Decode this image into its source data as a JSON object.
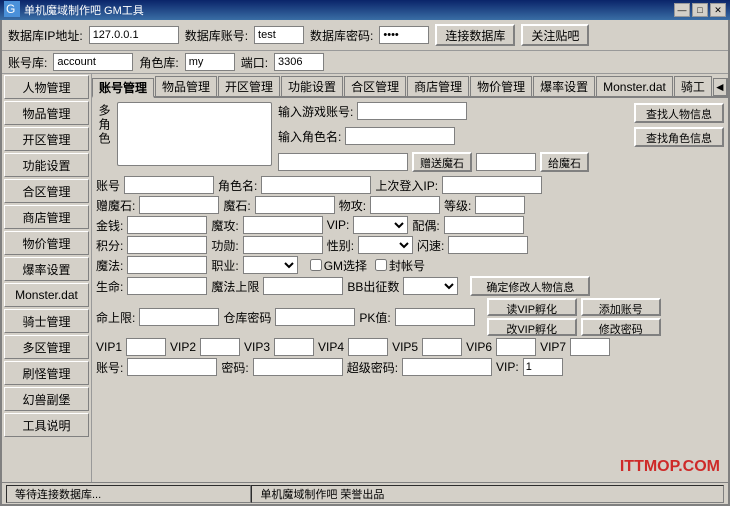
{
  "titleBar": {
    "title": "单机魔域制作吧 GM工具",
    "minimizeLabel": "—",
    "maximizeLabel": "□",
    "closeLabel": "✕"
  },
  "configBar": {
    "dbIpLabel": "数据库IP地址:",
    "dbIpValue": "127.0.0.1",
    "dbAccountLabel": "数据库账号:",
    "dbAccountValue": "test",
    "dbPasswordLabel": "数据库密码:",
    "dbPasswordValue": "****",
    "connectBtn": "连接数据库",
    "closeBtn": "关注贴吧"
  },
  "accountBar": {
    "dbLabel": "账号库:",
    "dbValue": "account",
    "roleLabel": "角色库:",
    "roleValue": "my",
    "portLabel": "端口:",
    "portValue": "3306"
  },
  "sidebar": {
    "items": [
      "人物管理",
      "物品管理",
      "开区管理",
      "功能设置",
      "合区管理",
      "商店管理",
      "物价管理",
      "爆率设置",
      "Monster.dat",
      "骑士管理",
      "多区管理",
      "刷怪管理",
      "幻兽副堡",
      "工具说明"
    ]
  },
  "tabs": {
    "items": [
      "账号管理",
      "物品管理",
      "开区管理",
      "功能设置",
      "合区管理",
      "商店管理",
      "物价管理",
      "爆率设置",
      "Monster.dat",
      "骑工"
    ],
    "activeIndex": 0,
    "navPrev": "◄",
    "navNext": "►"
  },
  "accountPanel": {
    "multiCharLabel": "多角色",
    "rightInputs": {
      "gameAccountLabel": "输入游戏账号:",
      "gameAccountValue": "",
      "roleNameLabel": "输入角色名:",
      "roleNameValue": "",
      "findAccountBtn": "查找人物信息",
      "findRoleBtn": "查找角色信息"
    },
    "giftMagicStoneBtn": "赠送魔石",
    "giveMagicStoneBtn": "给魔石",
    "infoRow1": {
      "accountLabel": "账号",
      "accountValue": "",
      "roleNameLabel": "角色名:",
      "roleNameValue": "",
      "lastLoginLabel": "上次登入IP:",
      "lastLoginValue": ""
    },
    "infoRow2": {
      "magicStoneLabel": "赠魔石:",
      "magicStoneValue": "",
      "magicLabel": "魔石:",
      "magicValue": "",
      "physAtkLabel": "物攻:",
      "physAtkValue": "",
      "levelLabel": "等级:",
      "levelValue": ""
    },
    "infoRow3": {
      "moneyLabel": "金钱:",
      "moneyValue": "",
      "magAtkLabel": "魔攻:",
      "magAtkValue": "",
      "vipLabel": "VIP:",
      "vipValue": "",
      "marriageLabel": "配偶:",
      "marriageValue": ""
    },
    "infoRow4": {
      "pointsLabel": "积分:",
      "pointsValue": "",
      "meritLabel": "功勋:",
      "meritValue": "",
      "genderLabel": "性别:",
      "genderValue": "",
      "flashLabel": "闪速:",
      "flashValue": ""
    },
    "infoRow5": {
      "magicMethodLabel": "魔法:",
      "magicMethodValue": "",
      "jobLabel": "职业:",
      "jobValue": ""
    },
    "gmCheckLabel": "GM选择",
    "sealLabel": "封帐号",
    "infoRow6": {
      "lifeLabel": "生命:",
      "lifeValue": "",
      "magicMaxLabel": "魔法上限",
      "magicMaxValue": "",
      "bbLabel": "BB出征数",
      "bbValue": ""
    },
    "confirmEditBtn": "确定修改人物信息",
    "infoRow7": {
      "lifeLimitLabel": "命上限:",
      "lifeLimitValue": "",
      "warehousePwdLabel": "仓库密码",
      "warehousePwdValue": "",
      "pkLabel": "PK值:",
      "pkValue": ""
    },
    "readVipBtn": "读VIP孵化",
    "changeVipBtn": "改VIP孵化",
    "addAccountBtn": "添加账号",
    "changePasswordBtn": "修改密码",
    "vipRow": {
      "vip1Label": "VIP1",
      "vip1Value": "",
      "vip2Label": "VIP2",
      "vip2Value": "",
      "vip3Label": "VIP3",
      "vip3Value": "",
      "vip4Label": "VIP4",
      "vip4Value": "",
      "vip5Label": "VIP5",
      "vip5Value": "",
      "vip6Label": "VIP6",
      "vip6Value": "",
      "vip7Label": "VIP7",
      "vip7Value": ""
    },
    "bottomRow": {
      "accountLabel": "账号:",
      "accountValue": "",
      "passwordLabel": "密码:",
      "passwordValue": "",
      "superPasswordLabel": "超级密码:",
      "superPasswordValue": "",
      "vipLabel": "VIP:",
      "vipValue": "1"
    }
  },
  "statusBar": {
    "waitingText": "等待连接数据库...",
    "creditText": "单机魔域制作吧 荣誉出品"
  },
  "watermark": "ITTMOP.COM"
}
